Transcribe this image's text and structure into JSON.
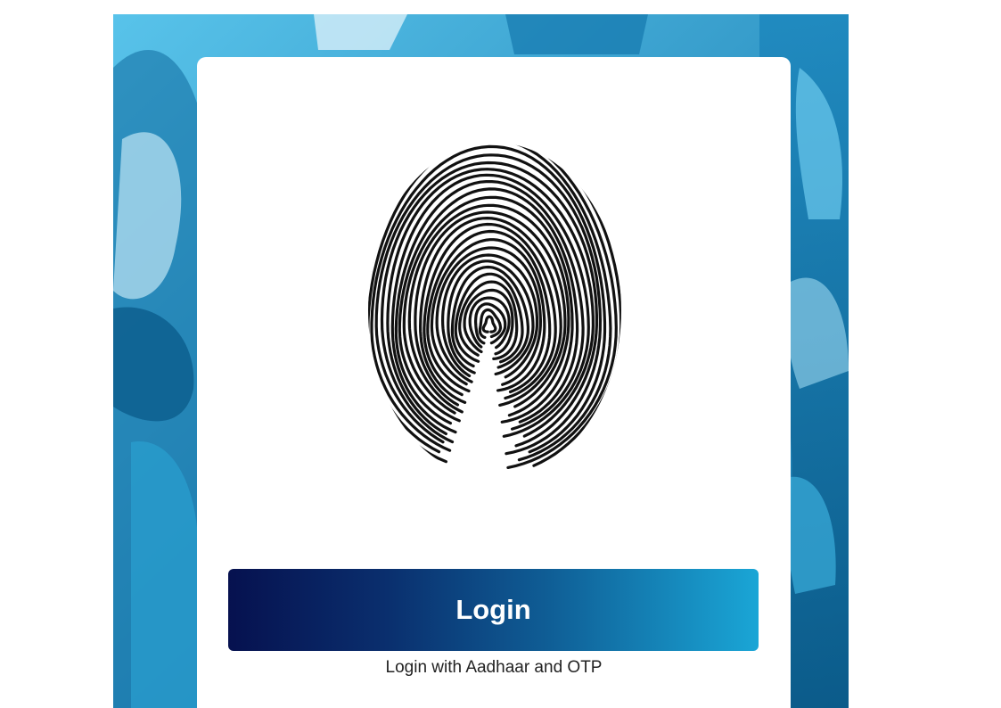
{
  "login": {
    "button_label": "Login",
    "caption": "Login with Aadhaar and OTP"
  },
  "colors": {
    "backdrop": "#2ea7d6",
    "card": "#ffffff",
    "button_gradient_start": "#06114f",
    "button_gradient_end": "#1aa6d6",
    "button_text": "#ffffff",
    "caption_text": "#222222"
  },
  "icons": {
    "fingerprint": "fingerprint-icon"
  }
}
